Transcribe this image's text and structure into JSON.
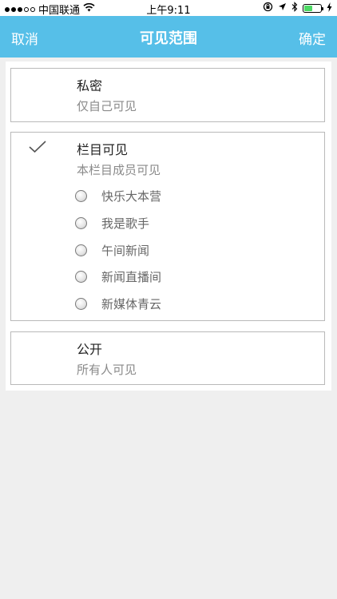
{
  "status_bar": {
    "carrier": "中国联通",
    "time": "上午9:11",
    "wifi_icon": "wifi-icon",
    "location_icon": "location-arrow-icon",
    "bluetooth_icon": "bluetooth-icon",
    "battery_icon": "battery-icon",
    "battery_level": 0.5
  },
  "nav": {
    "cancel_label": "取消",
    "title": "可见范围",
    "confirm_label": "确定"
  },
  "options": {
    "private": {
      "title": "私密",
      "subtitle": "仅自己可见"
    },
    "column": {
      "title": "栏目可见",
      "subtitle": "本栏目成员可见",
      "selected": true,
      "columns": [
        {
          "label": "快乐大本营"
        },
        {
          "label": "我是歌手"
        },
        {
          "label": "午间新闻"
        },
        {
          "label": "新闻直播间"
        },
        {
          "label": "新媒体青云"
        }
      ]
    },
    "public": {
      "title": "公开",
      "subtitle": "所有人可见"
    }
  },
  "colors": {
    "nav_bar": "#56bfe8",
    "background": "#efefef"
  }
}
